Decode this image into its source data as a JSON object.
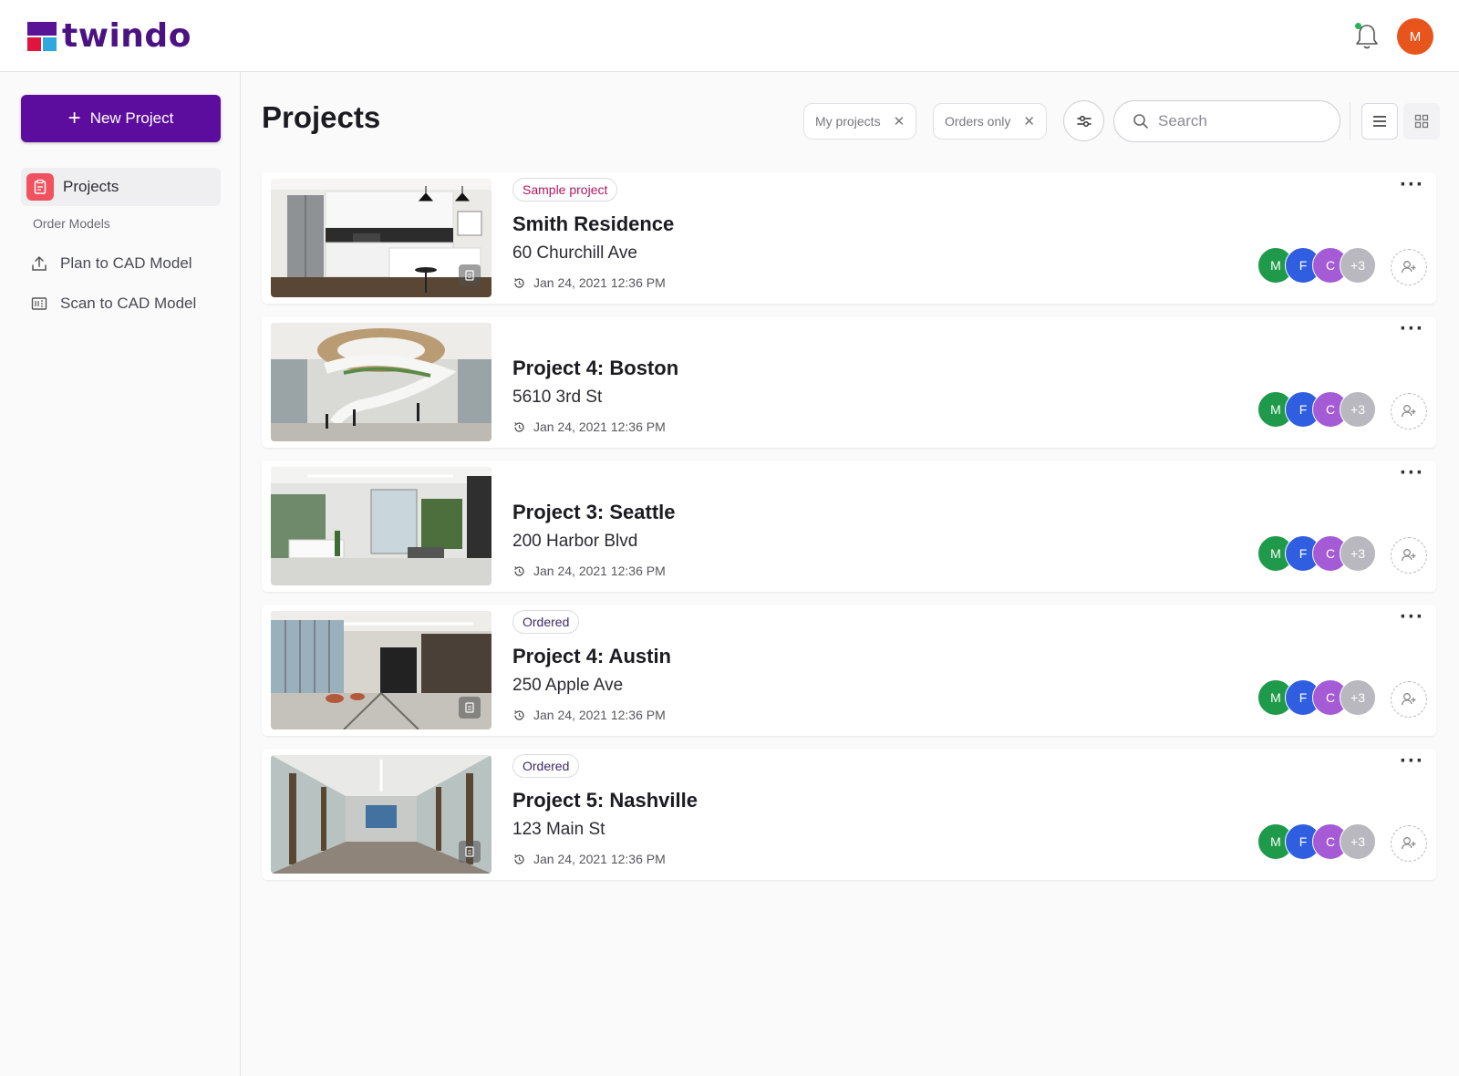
{
  "header": {
    "logo_text": "twindo",
    "user_initial": "M"
  },
  "sidebar": {
    "new_project_label": "New Project",
    "projects_label": "Projects",
    "section_label": "Order Models",
    "items": [
      {
        "label": "Plan to CAD Model",
        "icon": "upload-icon"
      },
      {
        "label": "Scan to CAD Model",
        "icon": "scan-icon"
      }
    ]
  },
  "main": {
    "title": "Projects",
    "filters": [
      {
        "label": "My projects"
      },
      {
        "label": "Orders only"
      }
    ],
    "search_placeholder": "Search",
    "view_modes": [
      "list",
      "grid"
    ],
    "active_view": "list"
  },
  "projects": [
    {
      "badge": "Sample project",
      "badge_kind": "sample",
      "title": "Smith Residence",
      "address": "60 Churchill Ave",
      "date": "Jan 24, 2021 12:36 PM",
      "members": [
        "M",
        "F",
        "C"
      ],
      "extra_members": "+3",
      "image": "kitchen"
    },
    {
      "badge": "",
      "badge_kind": "",
      "title": "Project 4: Boston",
      "address": "5610 3rd St",
      "date": "Jan 24, 2021 12:36 PM",
      "members": [
        "M",
        "F",
        "C"
      ],
      "extra_members": "+3",
      "image": "atrium"
    },
    {
      "badge": "",
      "badge_kind": "",
      "title": "Project 3: Seattle",
      "address": "200 Harbor Blvd",
      "date": "Jan 24, 2021 12:36 PM",
      "members": [
        "M",
        "F",
        "C"
      ],
      "extra_members": "+3",
      "image": "lobby"
    },
    {
      "badge": "Ordered",
      "badge_kind": "ordered",
      "title": "Project 4: Austin",
      "address": "250 Apple Ave",
      "date": "Jan 24, 2021 12:36 PM",
      "members": [
        "M",
        "F",
        "C"
      ],
      "extra_members": "+3",
      "image": "office"
    },
    {
      "badge": "Ordered",
      "badge_kind": "ordered",
      "title": "Project 5: Nashville",
      "address": "123 Main St",
      "date": "Jan 24, 2021 12:36 PM",
      "members": [
        "M",
        "F",
        "C"
      ],
      "extra_members": "+3",
      "image": "corridor"
    }
  ],
  "colors": {
    "brand": "#5d0d9e",
    "avatar_m": "#1f9a4a",
    "avatar_f": "#2f5fe0",
    "avatar_c": "#a65bd6",
    "avatar_more": "#b8b8be",
    "user_avatar": "#e8551c"
  }
}
